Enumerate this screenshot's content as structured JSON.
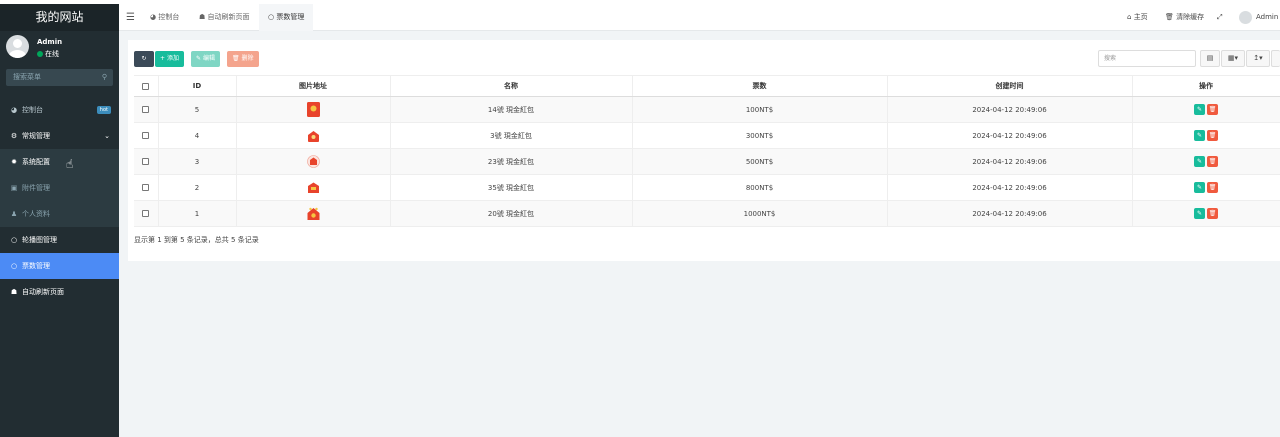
{
  "app": {
    "title": "我的网站"
  },
  "user": {
    "name": "Admin",
    "status": "在线"
  },
  "sidebar": {
    "search_placeholder": "搜索菜单",
    "items": [
      {
        "label": "控制台",
        "icon": "dashboard-icon",
        "glyph": "◕",
        "badge": "hot"
      },
      {
        "label": "常规管理",
        "icon": "cogs-icon",
        "glyph": "⚙"
      },
      {
        "label": "系统配置",
        "icon": "gear-icon",
        "glyph": "✹"
      },
      {
        "label": "附件管理",
        "icon": "file-image-icon",
        "glyph": "▣"
      },
      {
        "label": "个人资料",
        "icon": "user-icon",
        "glyph": "♟"
      },
      {
        "label": "轮播图管理",
        "icon": "circle-icon",
        "glyph": "○"
      },
      {
        "label": "票数管理",
        "icon": "circle-icon",
        "glyph": "○"
      },
      {
        "label": "自动刷新页面",
        "icon": "users-icon",
        "glyph": "☗"
      }
    ]
  },
  "topbar": {
    "tabs": [
      {
        "label": "控制台",
        "glyph": "◕"
      },
      {
        "label": "自动刷新页面",
        "glyph": "☗"
      },
      {
        "label": "票数管理",
        "glyph": "○"
      }
    ],
    "home_label": "主页",
    "clear_cache_label": "清除缓存",
    "fullscreen_glyph": "⤢",
    "user_label": "Admin"
  },
  "toolbar": {
    "refresh_glyph": "↻",
    "add_label": "添加",
    "edit_label": "编辑",
    "delete_label": "删除",
    "search_placeholder": "搜索"
  },
  "table": {
    "headers": [
      "ID",
      "图片地址",
      "名称",
      "票数",
      "创建时间",
      "操作"
    ],
    "rows": [
      {
        "id": "5",
        "name": "14號 現金紅包",
        "votes": "100NT$",
        "created": "2024-04-12 20:49:06"
      },
      {
        "id": "4",
        "name": "3號 現金紅包",
        "votes": "300NT$",
        "created": "2024-04-12 20:49:06"
      },
      {
        "id": "3",
        "name": "23號 現金紅包",
        "votes": "500NT$",
        "created": "2024-04-12 20:49:06"
      },
      {
        "id": "2",
        "name": "35號 現金紅包",
        "votes": "800NT$",
        "created": "2024-04-12 20:49:06"
      },
      {
        "id": "1",
        "name": "20號 現金紅包",
        "votes": "1000NT$",
        "created": "2024-04-12 20:49:06"
      }
    ],
    "footer": "显示第 1 到第 5 条记录，总共 5 条记录"
  },
  "colors": {
    "sidebar_bg": "#222d32",
    "active": "#4c8bf5",
    "add": "#18bc9c",
    "edit_disabled": "#7fd6c4",
    "delete_disabled": "#f4a48d",
    "refresh": "#3b4a58",
    "edit_action": "#18bc9c",
    "delete_action": "#f05a3e",
    "envelope": "#e8432b"
  }
}
